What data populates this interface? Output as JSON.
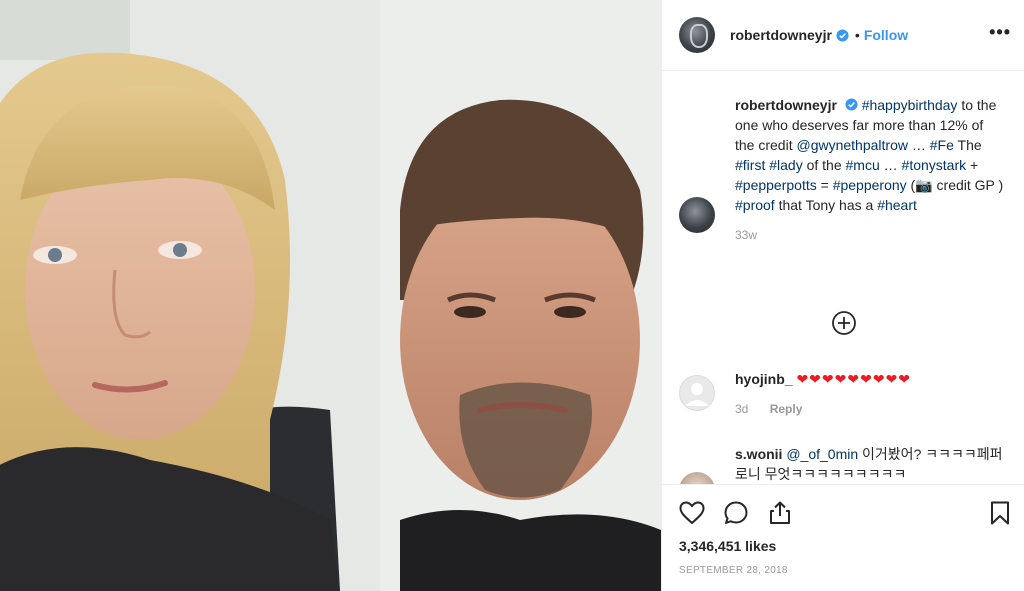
{
  "post": {
    "author": "robertdowneyjr",
    "follow_label": "Follow",
    "dot": "•",
    "more_label": "•••"
  },
  "caption": {
    "user": "robertdowneyjr",
    "parts": [
      {
        "t": "#happybirthday",
        "tag": true
      },
      {
        "t": " to the one who deserves far more than 12% of the credit ",
        "tag": false
      },
      {
        "t": "@gwynethpaltrow",
        "tag": true
      },
      {
        "t": " … ",
        "tag": false
      },
      {
        "t": "#Fe",
        "tag": true
      },
      {
        "t": " The ",
        "tag": false
      },
      {
        "t": "#first",
        "tag": true
      },
      {
        "t": " ",
        "tag": false
      },
      {
        "t": "#lady",
        "tag": true
      },
      {
        "t": " of the ",
        "tag": false
      },
      {
        "t": "#mcu",
        "tag": true
      },
      {
        "t": " … ",
        "tag": false
      },
      {
        "t": "#tonystark",
        "tag": true
      },
      {
        "t": " + ",
        "tag": false
      },
      {
        "t": "#pepperpotts",
        "tag": true
      },
      {
        "t": " = ",
        "tag": false
      },
      {
        "t": "#pepperony",
        "tag": true
      },
      {
        "t": " (📷 credit GP ) ",
        "tag": false
      },
      {
        "t": "#proof",
        "tag": true
      },
      {
        "t": " that Tony has a ",
        "tag": false
      },
      {
        "t": "#heart",
        "tag": true
      }
    ],
    "time": "33w"
  },
  "comments": [
    {
      "user": "hyojinb_",
      "text": "❤❤❤❤❤❤❤❤❤",
      "time": "3d",
      "reply_label": "Reply"
    },
    {
      "user": "s.wonii",
      "mention": "@_of_0min",
      "text": " 이거봤어? ㅋㅋㅋㅋ페퍼로니 무엇ㅋㅋㅋㅋㅋㅋㅋㅋㅋ"
    }
  ],
  "icons": {
    "like": "heart-outline-icon",
    "comment": "comment-bubble-icon",
    "share": "share-upload-icon",
    "save": "bookmark-icon",
    "load_more": "plus-circle-icon",
    "verified": "verified-badge-icon"
  },
  "stats": {
    "likes": "3,346,451 likes",
    "date": "SEPTEMBER 28, 2018"
  },
  "colors": {
    "link": "#003569",
    "follow": "#3897f0",
    "heart": "#ed1c24",
    "meta": "#999999"
  }
}
